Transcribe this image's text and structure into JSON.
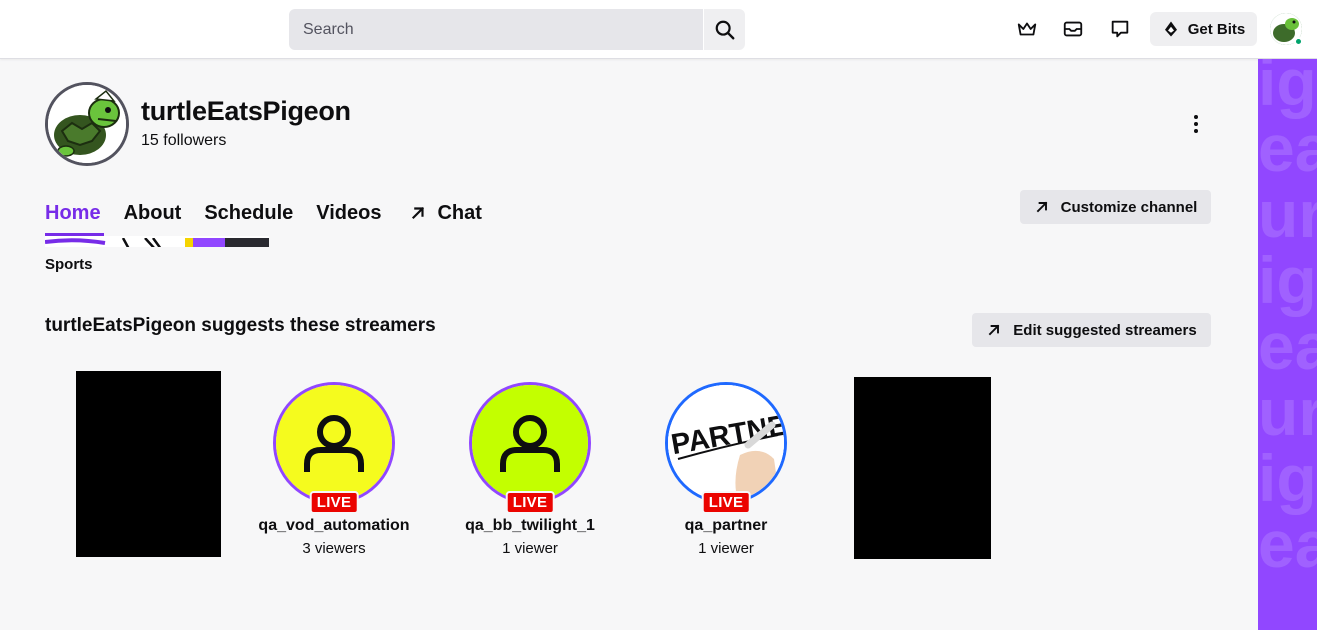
{
  "topnav": {
    "search_placeholder": "Search",
    "icons": [
      "crown-icon",
      "inbox-icon",
      "whispers-icon"
    ],
    "get_bits_label": "Get Bits"
  },
  "channel": {
    "name": "turtleEatsPigeon",
    "followers": "15 followers"
  },
  "tabs": [
    {
      "label": "Home",
      "active": true
    },
    {
      "label": "About",
      "active": false
    },
    {
      "label": "Schedule",
      "active": false
    },
    {
      "label": "Videos",
      "active": false
    },
    {
      "label": "Chat",
      "active": false,
      "icon": "external-arrow-icon"
    }
  ],
  "customize_label": "Customize channel",
  "sports_label": "Sports",
  "suggestions": {
    "title": "turtleEatsPigeon suggests these streamers",
    "edit_label": "Edit suggested streamers",
    "streamers": [
      {
        "name": "qa_vod_automation",
        "viewers": "3 viewers",
        "live": "LIVE",
        "avatar_color": "#f5fb1e",
        "ring_color": "#9147ff"
      },
      {
        "name": "qa_bb_twilight_1",
        "viewers": "1 viewer",
        "live": "LIVE",
        "avatar_color": "#c3ff00",
        "ring_color": "#9147ff"
      },
      {
        "name": "qa_partner",
        "viewers": "1 viewer",
        "live": "LIVE",
        "avatar_text": "PARTNER",
        "ring_color": "#1f69ff"
      }
    ]
  },
  "purple_text": "ig\nea\nur\nig\nea\nur\nig\nea",
  "colors": {
    "accent": "#772ce8",
    "brand_purple": "#9147ff",
    "live_red": "#eb0400"
  }
}
